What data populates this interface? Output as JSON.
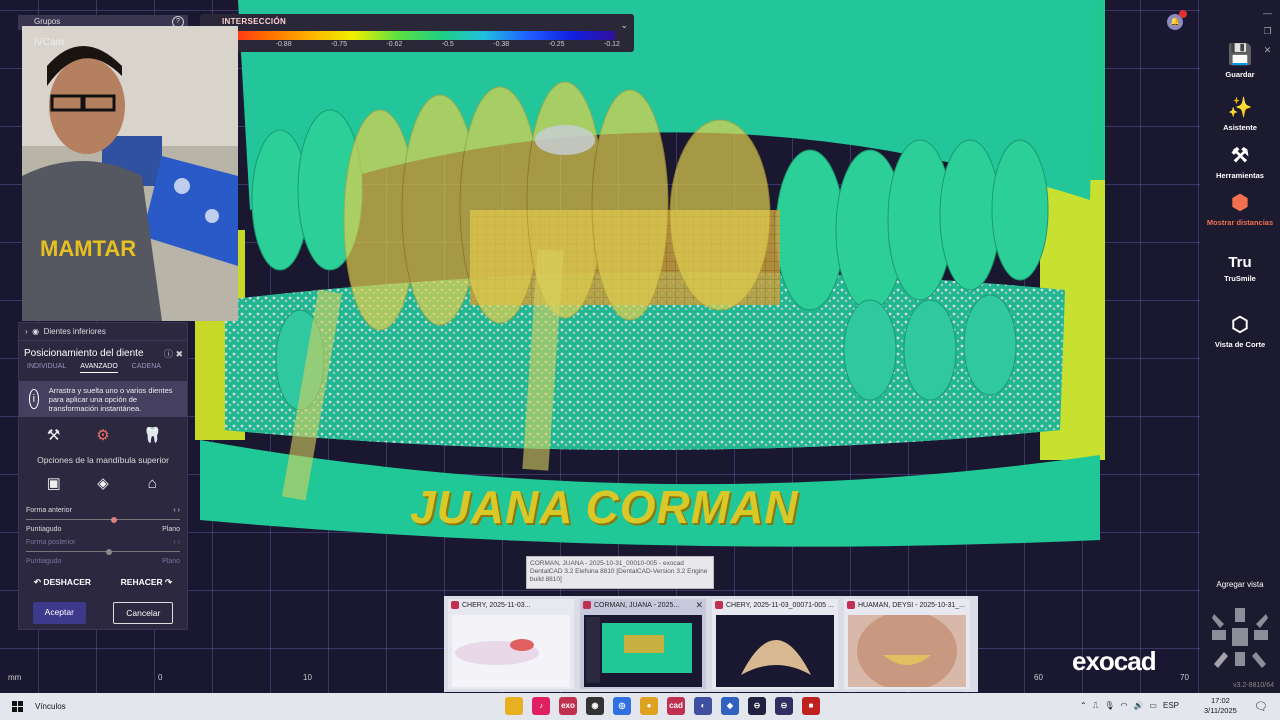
{
  "scale": {
    "title": "INTERSECCIÓN",
    "ticks": [
      "-1",
      "-0.88",
      "-0.75",
      "-0.62",
      "-0.5",
      "-0.38",
      "-0.25",
      "-0.12"
    ]
  },
  "left_panel": {
    "grupos_label": "Grupos",
    "webcam_label": "iVCam",
    "dientes_item": "Dientes inferiores",
    "title": "Posicionamiento del diente",
    "tabs": [
      "INDIVIDUAL",
      "AVANZADO",
      "CADENA"
    ],
    "active_tab": "AVANZADO",
    "info_text": "Arrastra y suelta uno o varios dientes para aplicar una opción de transformación instantánea.",
    "options_label": "Opciones de la mandíbula superior",
    "slider_anterior": {
      "label": "Forma anterior",
      "left": "Puntiagudo",
      "right": "Plano",
      "value": 0.55
    },
    "slider_posterior": {
      "label": "Forma posterior",
      "left": "Puntiagudo",
      "right": "Plano",
      "value": 0.52
    },
    "undo": "DESHACER",
    "redo": "REHACER",
    "accept": "Aceptar",
    "cancel": "Cancelar"
  },
  "model_label": "JUANA CORMAN",
  "right_toolbar": {
    "items": [
      {
        "label": "Guardar",
        "icon": "save-icon"
      },
      {
        "label": "Asistente",
        "icon": "wizard-icon"
      },
      {
        "label": "Herramientas",
        "icon": "tools-icon"
      },
      {
        "label": "Mostrar distancias",
        "icon": "distances-icon"
      },
      {
        "label": "TruSmile",
        "icon": "trusmile-icon"
      },
      {
        "label": "Vista de Corte",
        "icon": "cut-view-icon"
      }
    ],
    "add_view": "Agregar vista",
    "version": "v3.2-8810/64",
    "tru_text": "Tru"
  },
  "notification_count": "0",
  "axis_labels": {
    "unit": "mm",
    "a": "0",
    "b": "10",
    "c": "60",
    "d": "70"
  },
  "logo": "exocad",
  "tooltip": "CORMAN, JUANA - 2025-10-31_00010-005 - exocad DentalCAD 3.2 Elefsina 8810 [DentalCAD-Version 3.2 Engine build 8810]",
  "previews": [
    {
      "title": "CHERY, 2025-11-03..."
    },
    {
      "title": "CORMAN, JUANA - 2025..."
    },
    {
      "title": "CHERY, 2025-11-03_00071-005 ..."
    },
    {
      "title": "HUAMAN, DEYSI - 2025-10-31_..."
    }
  ],
  "taskbar": {
    "links": "Vínculos",
    "lang": "ESP",
    "time": "17:02",
    "date": "3/11/2025",
    "apps": [
      {
        "label": "",
        "color": "#e8b020",
        "icon": "folder-icon"
      },
      {
        "label": "♪",
        "color": "#e02060",
        "icon": "tiktok-icon"
      },
      {
        "label": "exo",
        "color": "#c03050",
        "icon": "exocad-icon"
      },
      {
        "label": "◉",
        "color": "#333333",
        "icon": "obs-icon"
      },
      {
        "label": "◎",
        "color": "#3070e0",
        "icon": "edge-icon"
      },
      {
        "label": "●",
        "color": "#e0a020",
        "icon": "chrome-icon"
      },
      {
        "label": "cad",
        "color": "#c03050",
        "icon": "dentalcad-icon"
      },
      {
        "label": "◐",
        "color": "#4050a0",
        "icon": "app-icon"
      },
      {
        "label": "◆",
        "color": "#3060c0",
        "icon": "app2-icon"
      },
      {
        "label": "⊖",
        "color": "#202040",
        "icon": "app3-icon"
      },
      {
        "label": "⊖",
        "color": "#303060",
        "icon": "app4-icon"
      },
      {
        "label": "■",
        "color": "#c02020",
        "icon": "record-icon"
      }
    ]
  }
}
